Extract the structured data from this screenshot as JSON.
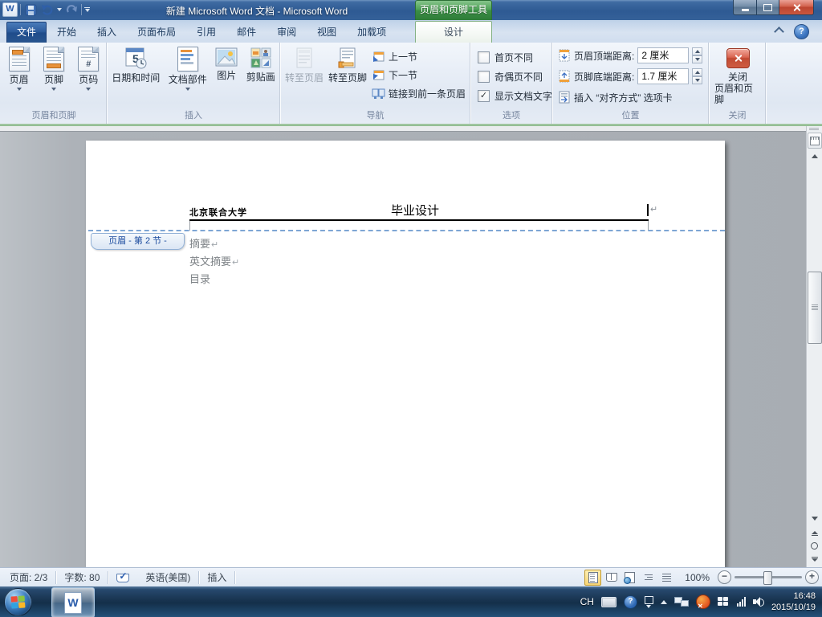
{
  "titlebar": {
    "title": "新建 Microsoft Word 文档 - Microsoft Word",
    "contextual_tool_label": "页眉和页脚工具"
  },
  "tabs": {
    "file": "文件",
    "items": [
      "开始",
      "插入",
      "页面布局",
      "引用",
      "邮件",
      "审阅",
      "视图",
      "加载项"
    ],
    "contextual": "设计"
  },
  "ribbon": {
    "header_footer": {
      "label": "页眉和页脚",
      "header": "页眉",
      "footer": "页脚",
      "page_number": "页码"
    },
    "insert": {
      "label": "插入",
      "datetime": "日期和时间",
      "quick_parts": "文档部件",
      "picture": "图片",
      "clipart": "剪贴画"
    },
    "navigation": {
      "label": "导航",
      "goto_header": "转至页眉",
      "goto_footer": "转至页脚",
      "prev_section": "上一节",
      "next_section": "下一节",
      "link_to_previous": "链接到前一条页眉"
    },
    "options": {
      "label": "选项",
      "different_first_page": "首页不同",
      "different_first_page_checked": false,
      "different_odd_even": "奇偶页不同",
      "different_odd_even_checked": false,
      "show_document_text": "显示文档文字",
      "show_document_text_checked": true,
      "checkmark": "✓"
    },
    "position": {
      "label": "位置",
      "header_from_top_label": "页眉顶端距离:",
      "header_from_top_value": "2 厘米",
      "footer_from_bottom_label": "页脚底端距离:",
      "footer_from_bottom_value": "1.7 厘米",
      "insert_alignment_tab": "插入 “对齐方式” 选项卡"
    },
    "close": {
      "label": "关闭",
      "button_line1": "关闭",
      "button_line2": "页眉和页脚"
    }
  },
  "document": {
    "header_left": "北京联合大学",
    "header_center": "毕业设计",
    "header_tag": "页眉 - 第 2 节 -",
    "body_line1": "摘要",
    "body_line2": "英文摘要",
    "body_line3": "目录",
    "return_mark": "↵"
  },
  "statusbar": {
    "page": "页面: 2/3",
    "words": "字数: 80",
    "language": "英语(美国)",
    "mode": "插入",
    "zoom": "100%"
  },
  "taskbar": {
    "tray_language": "CH",
    "time": "16:48",
    "date": "2015/10/19"
  },
  "icons": {
    "help": "?",
    "word_logo": "W",
    "page_number_hash": "#",
    "spell_check": "✓",
    "date_number": "5"
  },
  "colors": {
    "contextual_tab_green": "#3b8d45",
    "file_tab_blue": "#2c5b9c",
    "close_button_red": "#c24a33",
    "view_selected_orange": "#f7d575",
    "header_boundary_dashed_blue": "#7ea6d4"
  }
}
